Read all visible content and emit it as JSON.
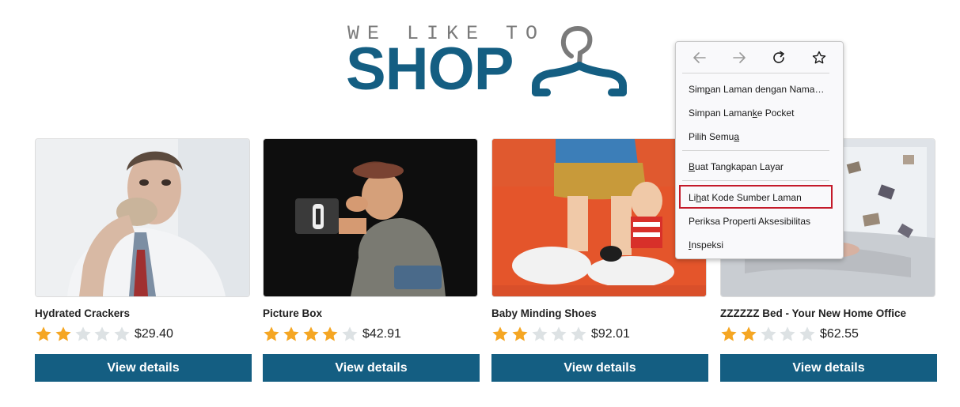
{
  "logo": {
    "tagline": "WE LIKE TO",
    "title": "SHOP",
    "icon": "hanger-icon"
  },
  "colors": {
    "brand": "#145e82",
    "star_filled": "#f5a623",
    "star_empty": "#dde2e4",
    "highlight": "#c41a2a"
  },
  "products": [
    {
      "name": "Hydrated Crackers",
      "rating": 2,
      "rating_max": 5,
      "price": "$29.40",
      "button": "View details"
    },
    {
      "name": "Picture Box",
      "rating": 4,
      "rating_max": 5,
      "price": "$42.91",
      "button": "View details"
    },
    {
      "name": "Baby Minding Shoes",
      "rating": 2,
      "rating_max": 5,
      "price": "$92.01",
      "button": "View details"
    },
    {
      "name": "ZZZZZZ Bed - Your New Home Office",
      "rating": 2,
      "rating_max": 5,
      "price": "$62.55",
      "button": "View details"
    }
  ],
  "context_menu": {
    "nav_icons": [
      "back-arrow-icon",
      "forward-arrow-icon",
      "reload-icon",
      "bookmark-star-icon"
    ],
    "items": [
      {
        "pre": "Sim",
        "key": "p",
        "post": "an Laman dengan Nama…"
      },
      {
        "pre": "Simpan Laman ",
        "key": "k",
        "post": "e Pocket"
      },
      {
        "pre": "Pilih Semu",
        "key": "a",
        "post": ""
      },
      {
        "pre": "",
        "key": "B",
        "post": "uat Tangkapan Layar"
      },
      {
        "pre": "Li",
        "key": "h",
        "post": "at Kode Sumber Laman"
      },
      {
        "pre": "Periksa Properti Aksesibilitas",
        "key": "",
        "post": ""
      },
      {
        "pre": "",
        "key": "I",
        "post": "nspeksi"
      }
    ],
    "highlighted_item": "Lihat Kode Sumber Laman"
  }
}
